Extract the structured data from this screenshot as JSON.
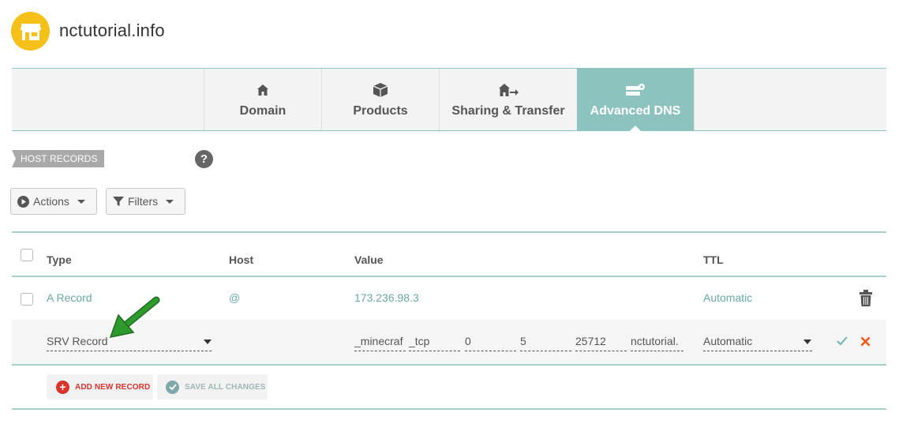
{
  "site": {
    "title": "nctutorial.info",
    "logo_icon": "storefront-icon",
    "logo_color": "#f5c018"
  },
  "tabs": [
    {
      "label": "Domain",
      "icon": "house-icon"
    },
    {
      "label": "Products",
      "icon": "box-icon"
    },
    {
      "label": "Sharing & Transfer",
      "icon": "house-arrow-icon"
    },
    {
      "label": "Advanced DNS",
      "icon": "server-gear-icon",
      "active": true
    }
  ],
  "section": {
    "label": "HOST RECORDS",
    "help": "?"
  },
  "toolbar": {
    "actions_label": "Actions",
    "filters_label": "Filters"
  },
  "table": {
    "headers": {
      "type": "Type",
      "host": "Host",
      "value": "Value",
      "ttl": "TTL"
    },
    "rows": [
      {
        "type": "A Record",
        "host": "@",
        "value": "173.236.98.3",
        "ttl": "Automatic"
      }
    ],
    "edit_row": {
      "type": "SRV Record",
      "service": "_minecraf",
      "protocol": "_tcp",
      "priority": "0",
      "weight": "5",
      "port": "25712",
      "target": "nctutorial.",
      "ttl": "Automatic"
    }
  },
  "buttons": {
    "add_new_record": "ADD NEW RECORD",
    "save_all_changes": "SAVE ALL CHANGES"
  },
  "colors": {
    "accent": "#8dc3bf",
    "add_red": "#d9332b",
    "confirm_green": "#6cb8a9",
    "cancel_orange": "#f05a1a",
    "arrow_green": "#2e9a2e"
  }
}
